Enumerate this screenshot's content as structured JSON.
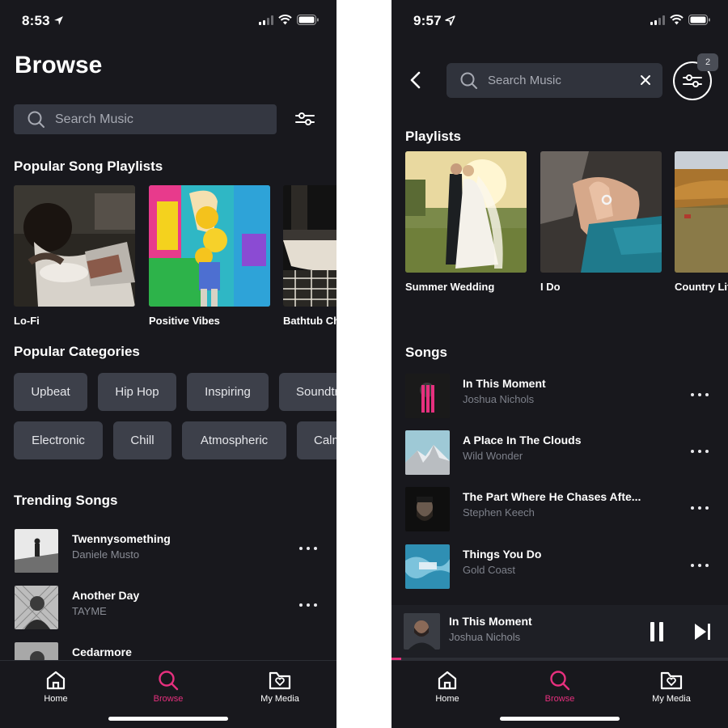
{
  "colors": {
    "accent": "#e6307e",
    "background": "#18181d",
    "surface": "#343741",
    "pill": "#3d404a",
    "muted_text": "#8a8d96"
  },
  "left": {
    "status": {
      "time": "8:53"
    },
    "title": "Browse",
    "search": {
      "placeholder": "Search Music"
    },
    "popular_playlists": {
      "heading": "Popular Song Playlists",
      "items": [
        {
          "label": "Lo-Fi"
        },
        {
          "label": "Positive Vibes"
        },
        {
          "label": "Bathtub Ch"
        }
      ]
    },
    "popular_categories": {
      "heading": "Popular Categories",
      "row1": [
        "Upbeat",
        "Hip Hop",
        "Inspiring",
        "Soundtr"
      ],
      "row2": [
        "Electronic",
        "Chill",
        "Atmospheric",
        "Calm"
      ]
    },
    "trending": {
      "heading": "Trending Songs",
      "items": [
        {
          "title": "Twennysomething",
          "artist": "Daniele Musto"
        },
        {
          "title": "Another Day",
          "artist": "TAYME"
        },
        {
          "title": "Cedarmore",
          "artist": ""
        }
      ]
    },
    "tabs": [
      {
        "label": "Home",
        "icon": "home-icon"
      },
      {
        "label": "Browse",
        "icon": "search-icon"
      },
      {
        "label": "My Media",
        "icon": "folder-heart-icon"
      }
    ]
  },
  "right": {
    "status": {
      "time": "9:57"
    },
    "search": {
      "placeholder": "Search Music"
    },
    "filter_badge": "2",
    "playlists": {
      "heading": "Playlists",
      "items": [
        {
          "label": "Summer Wedding"
        },
        {
          "label": "I Do"
        },
        {
          "label": "Country Lif"
        }
      ]
    },
    "songs": {
      "heading": "Songs",
      "items": [
        {
          "title": "In This Moment",
          "artist": "Joshua Nichols"
        },
        {
          "title": "A Place In The Clouds",
          "artist": "Wild Wonder"
        },
        {
          "title": "The Part Where He Chases Afte...",
          "artist": "Stephen Keech"
        },
        {
          "title": "Things You Do",
          "artist": "Gold Coast"
        }
      ]
    },
    "now_playing": {
      "title": "In This Moment",
      "artist": "Joshua Nichols",
      "progress": 0.03
    },
    "tabs": [
      {
        "label": "Home",
        "icon": "home-icon"
      },
      {
        "label": "Browse",
        "icon": "search-icon"
      },
      {
        "label": "My Media",
        "icon": "folder-heart-icon"
      }
    ]
  }
}
